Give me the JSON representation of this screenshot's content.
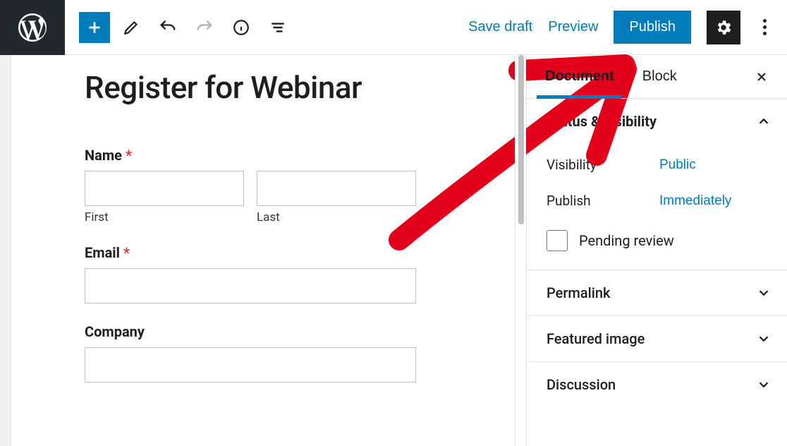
{
  "toolbar": {
    "save_draft": "Save draft",
    "preview": "Preview",
    "publish": "Publish"
  },
  "editor": {
    "title": "Register for Webinar",
    "fields": {
      "name": {
        "label": "Name",
        "required_mark": "*",
        "first_sub": "First",
        "last_sub": "Last"
      },
      "email": {
        "label": "Email",
        "required_mark": "*"
      },
      "company": {
        "label": "Company"
      }
    }
  },
  "sidebar": {
    "tabs": {
      "document": "Document",
      "block": "Block"
    },
    "status_panel": {
      "title": "Status & visibility",
      "visibility_label": "Visibility",
      "visibility_value": "Public",
      "publish_label": "Publish",
      "publish_value": "Immediately",
      "pending_label": "Pending review"
    },
    "permalink": "Permalink",
    "featured_image": "Featured image",
    "discussion": "Discussion"
  },
  "icons": {
    "wp": "wordpress-logo",
    "add": "plus",
    "edit": "pencil",
    "undo": "undo",
    "redo": "redo",
    "info": "info-circle",
    "outline": "list-outline",
    "settings": "gear",
    "more": "more-vertical",
    "close": "close",
    "chev_up": "chevron-up",
    "chev_down": "chevron-down"
  }
}
